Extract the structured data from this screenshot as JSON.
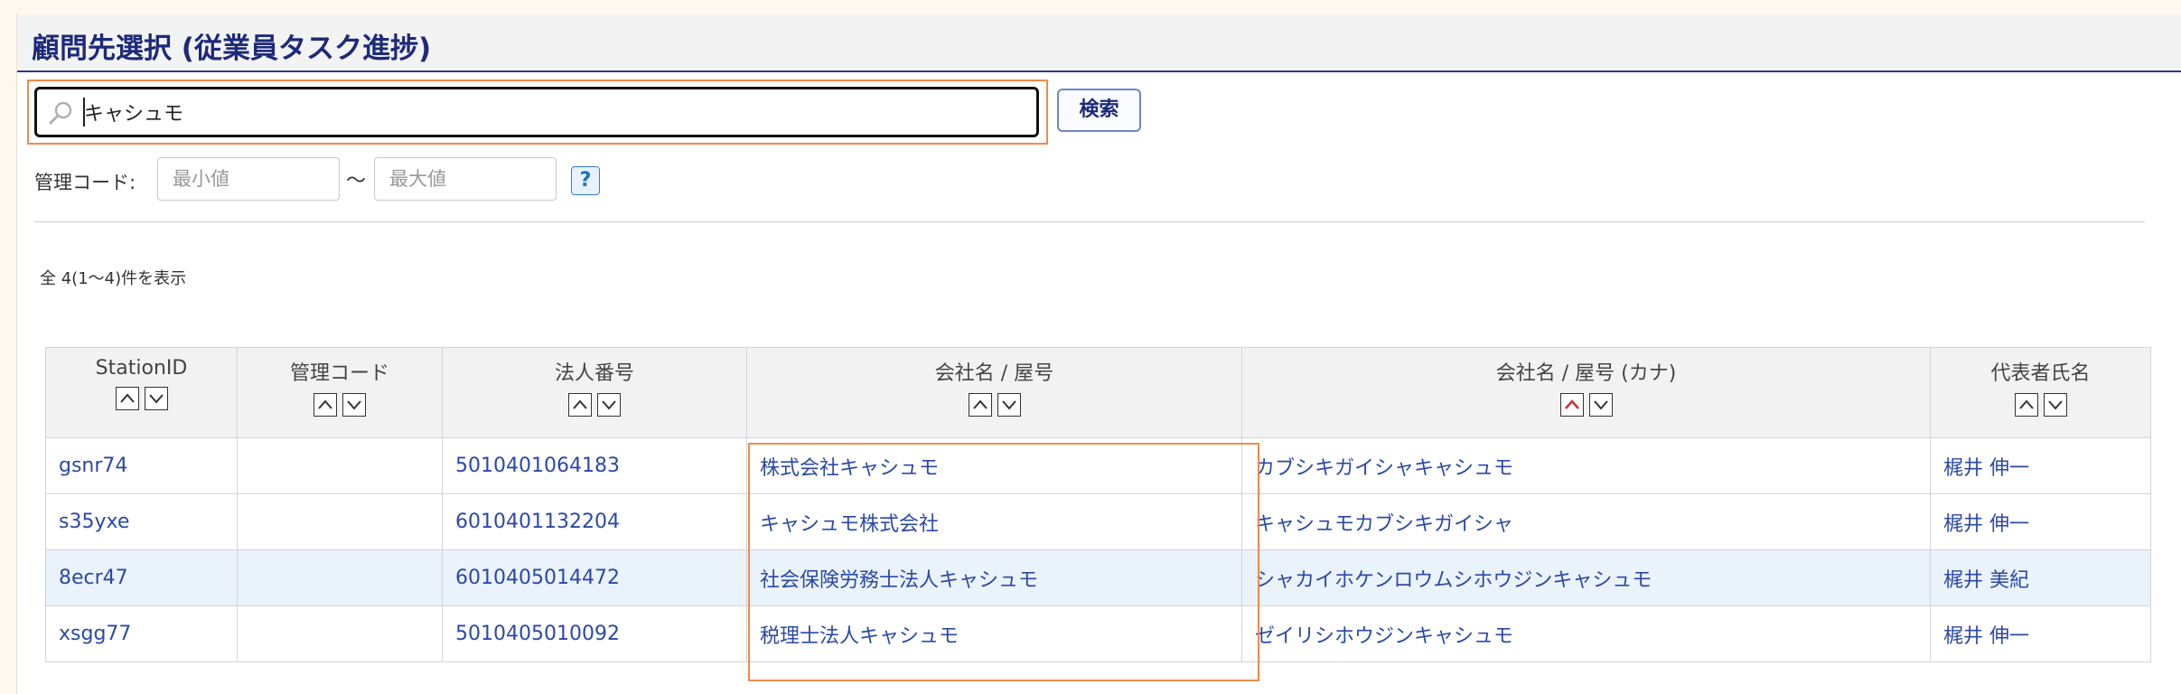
{
  "page": {
    "title": "顧問先選択 (従業員タスク進捗)"
  },
  "search": {
    "value": "キャシュモ",
    "icon": "search-icon",
    "button_label": "検索"
  },
  "filter": {
    "kanri_label": "管理コード:",
    "min_placeholder": "最小値",
    "max_placeholder": "最大値",
    "tilde": "〜",
    "help_label": "?"
  },
  "results": {
    "count_text": "全 4(1〜4)件を表示"
  },
  "table": {
    "columns": [
      {
        "label": "StationID",
        "sort_active": "none"
      },
      {
        "label": "管理コード",
        "sort_active": "none"
      },
      {
        "label": "法人番号",
        "sort_active": "none"
      },
      {
        "label": "会社名 / 屋号",
        "sort_active": "none"
      },
      {
        "label": "会社名 / 屋号 (カナ)",
        "sort_active": "asc"
      },
      {
        "label": "代表者氏名",
        "sort_active": "none"
      }
    ],
    "rows": [
      {
        "station_id": "gsnr74",
        "kanri_code": "",
        "houjin_bangou": "5010401064183",
        "company": "株式会社キャシュモ",
        "company_kana": "カブシキガイシャキャシュモ",
        "representative": "梶井 伸一"
      },
      {
        "station_id": "s35yxe",
        "kanri_code": "",
        "houjin_bangou": "6010401132204",
        "company": "キャシュモ株式会社",
        "company_kana": "キャシュモカブシキガイシャ",
        "representative": "梶井 伸一"
      },
      {
        "station_id": "8ecr47",
        "kanri_code": "",
        "houjin_bangou": "6010405014472",
        "company": "社会保険労務士法人キャシュモ",
        "company_kana": "シャカイホケンロウムシホウジンキャシュモ",
        "representative": "梶井 美紀"
      },
      {
        "station_id": "xsgg77",
        "kanri_code": "",
        "houjin_bangou": "5010405010092",
        "company": "税理士法人キャシュモ",
        "company_kana": "ゼイリシホウジンキャシュモ",
        "representative": "梶井 伸一"
      }
    ]
  },
  "colors": {
    "title": "#1d2a7a",
    "link": "#2b49a8",
    "highlight": "#f08a4b",
    "row_alt": "#eaf2fb",
    "sort_active": "#d0312d"
  }
}
